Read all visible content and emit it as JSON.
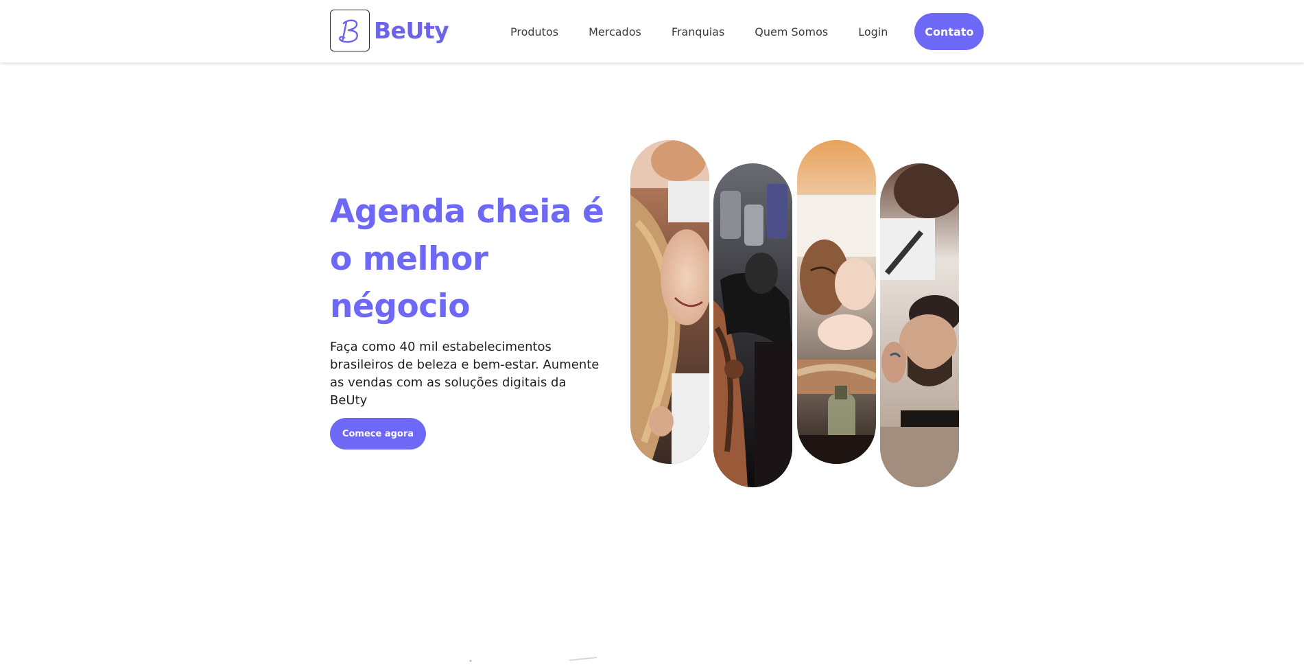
{
  "header": {
    "brand": "BeUty",
    "nav": [
      "Produtos",
      "Mercados",
      "Franquias",
      "Quem Somos",
      "Login"
    ],
    "contact_label": "Contato"
  },
  "hero": {
    "title_lines": [
      "Agenda cheia é",
      "o melhor",
      "négocio"
    ],
    "subtitle_lines": [
      "Faça como 40 mil estabelecimentos",
      "brasileiros de beleza e bem-estar. Aumente",
      "as vendas com as soluções digitais da BeUty"
    ],
    "cta_label": "Comece agora"
  },
  "colors": {
    "accent": "#6d68f6",
    "text": "#1f1f1f"
  },
  "images": [
    {
      "name": "hair-stylist-photo"
    },
    {
      "name": "tattoo-artist-photo"
    },
    {
      "name": "facial-treatment-photo"
    },
    {
      "name": "barber-photo"
    }
  ]
}
